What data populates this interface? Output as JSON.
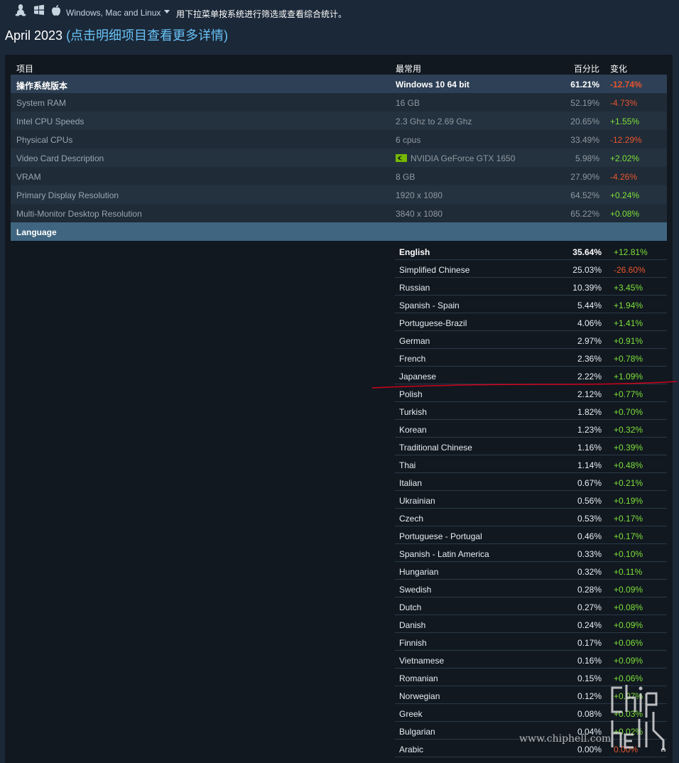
{
  "platform_filter": {
    "icons": [
      "linux-icon",
      "windows-icon",
      "apple-icon"
    ],
    "selected": "Windows, Mac and Linux",
    "hint": "用下拉菜单按系统进行筛选或查看综合统计。"
  },
  "title": {
    "date": "April 2023",
    "subtitle": " (点击明细项目查看更多详情)"
  },
  "table": {
    "headers": {
      "item": "项目",
      "common": "最常用",
      "percent": "百分比",
      "change": "变化"
    },
    "rows": [
      {
        "item": "操作系统版本",
        "common": "Windows 10 64 bit",
        "percent": "61.21%",
        "change": "-12.74%"
      },
      {
        "item": "System RAM",
        "common": "16 GB",
        "percent": "52.19%",
        "change": "-4.73%"
      },
      {
        "item": "Intel CPU Speeds",
        "common": "2.3 Ghz to 2.69 Ghz",
        "percent": "20.65%",
        "change": "+1.55%"
      },
      {
        "item": "Physical CPUs",
        "common": "6 cpus",
        "percent": "33.49%",
        "change": "-12.29%"
      },
      {
        "item": "Video Card Description",
        "common": "NVIDIA GeForce GTX 1650",
        "percent": "5.98%",
        "change": "+2.02%"
      },
      {
        "item": "VRAM",
        "common": "8 GB",
        "percent": "27.90%",
        "change": "-4.26%"
      },
      {
        "item": "Primary Display Resolution",
        "common": "1920 x 1080",
        "percent": "64.52%",
        "change": "+0.24%"
      },
      {
        "item": "Multi-Monitor Desktop Resolution",
        "common": "3840 x 1080",
        "percent": "65.22%",
        "change": "+0.08%"
      }
    ],
    "language_header": "Language"
  },
  "languages": [
    {
      "name": "English",
      "percent": "35.64%",
      "change": "+12.81%"
    },
    {
      "name": "Simplified Chinese",
      "percent": "25.03%",
      "change": "-26.60%"
    },
    {
      "name": "Russian",
      "percent": "10.39%",
      "change": "+3.45%"
    },
    {
      "name": "Spanish - Spain",
      "percent": "5.44%",
      "change": "+1.94%"
    },
    {
      "name": "Portuguese-Brazil",
      "percent": "4.06%",
      "change": "+1.41%"
    },
    {
      "name": "German",
      "percent": "2.97%",
      "change": "+0.91%"
    },
    {
      "name": "French",
      "percent": "2.36%",
      "change": "+0.78%"
    },
    {
      "name": "Japanese",
      "percent": "2.22%",
      "change": "+1.09%"
    },
    {
      "name": "Polish",
      "percent": "2.12%",
      "change": "+0.77%"
    },
    {
      "name": "Turkish",
      "percent": "1.82%",
      "change": "+0.70%"
    },
    {
      "name": "Korean",
      "percent": "1.23%",
      "change": "+0.32%"
    },
    {
      "name": "Traditional Chinese",
      "percent": "1.16%",
      "change": "+0.39%"
    },
    {
      "name": "Thai",
      "percent": "1.14%",
      "change": "+0.48%"
    },
    {
      "name": "Italian",
      "percent": "0.67%",
      "change": "+0.21%"
    },
    {
      "name": "Ukrainian",
      "percent": "0.56%",
      "change": "+0.19%"
    },
    {
      "name": "Czech",
      "percent": "0.53%",
      "change": "+0.17%"
    },
    {
      "name": "Portuguese - Portugal",
      "percent": "0.46%",
      "change": "+0.17%"
    },
    {
      "name": "Spanish - Latin America",
      "percent": "0.33%",
      "change": "+0.10%"
    },
    {
      "name": "Hungarian",
      "percent": "0.32%",
      "change": "+0.11%"
    },
    {
      "name": "Swedish",
      "percent": "0.28%",
      "change": "+0.09%"
    },
    {
      "name": "Dutch",
      "percent": "0.27%",
      "change": "+0.08%"
    },
    {
      "name": "Danish",
      "percent": "0.24%",
      "change": "+0.09%"
    },
    {
      "name": "Finnish",
      "percent": "0.17%",
      "change": "+0.06%"
    },
    {
      "name": "Vietnamese",
      "percent": "0.16%",
      "change": "+0.09%"
    },
    {
      "name": "Romanian",
      "percent": "0.15%",
      "change": "+0.06%"
    },
    {
      "name": "Norwegian",
      "percent": "0.12%",
      "change": "+0.07%"
    },
    {
      "name": "Greek",
      "percent": "0.08%",
      "change": "+0.03%"
    },
    {
      "name": "Bulgarian",
      "percent": "0.04%",
      "change": "+0.02%"
    },
    {
      "name": "Arabic",
      "percent": "0.00%",
      "change": "0.00%"
    }
  ],
  "watermark": "www.chiphell.com",
  "colors": {
    "positive": "#7ee03a",
    "negative": "#e8552f",
    "background": "#1b2838",
    "link": "#67c1f5",
    "annotation": "#d0021b"
  }
}
